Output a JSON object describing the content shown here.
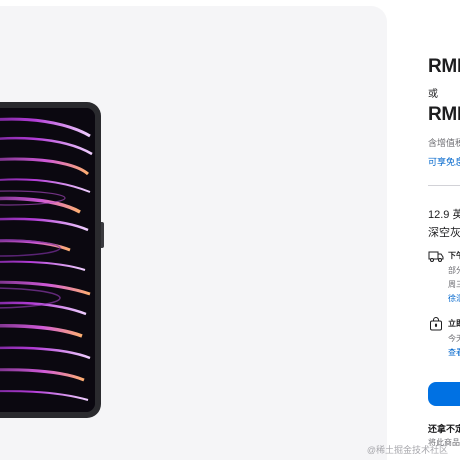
{
  "pricing": {
    "price_one": "RMB",
    "or_text": "或",
    "price_two": "RMB",
    "tax_note": "含增值税",
    "offer_link": "可享免息"
  },
  "config": {
    "model": "12.9 英",
    "color": "深空灰"
  },
  "delivery": {
    "title": "下午",
    "line1": "部分",
    "line2": "周三",
    "link": "徐汇"
  },
  "pickup": {
    "title": "立即",
    "line1": "今天",
    "link": "查看"
  },
  "footer": {
    "still_deciding": "还拿不定",
    "compare_note": "将此商品"
  },
  "watermark": "@稀土掘金技术社区",
  "colors": {
    "accent": "#0071e3",
    "link": "#0066cc",
    "gallery_bg": "#f5f5f7"
  }
}
